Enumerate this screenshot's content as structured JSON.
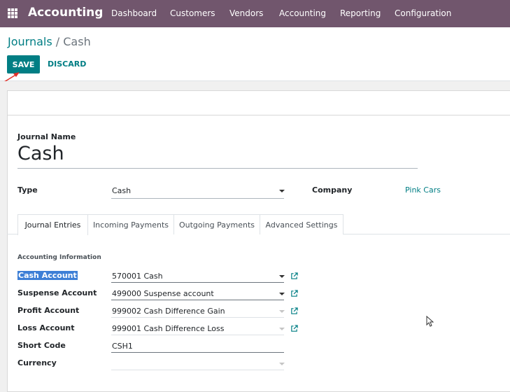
{
  "navbar": {
    "app_name": "Accounting",
    "menu": [
      "Dashboard",
      "Customers",
      "Vendors",
      "Accounting",
      "Reporting",
      "Configuration"
    ]
  },
  "breadcrumb": {
    "parent": "Journals",
    "separator": "/",
    "current": "Cash"
  },
  "buttons": {
    "save": "SAVE",
    "discard": "DISCARD"
  },
  "form": {
    "journal_name_label": "Journal Name",
    "journal_name": "Cash",
    "type_label": "Type",
    "type_value": "Cash",
    "company_label": "Company",
    "company_value": "Pink Cars"
  },
  "tabs": [
    "Journal Entries",
    "Incoming Payments",
    "Outgoing Payments",
    "Advanced Settings"
  ],
  "accounting": {
    "section_title": "Accounting Information",
    "cash_account_label": "Cash Account",
    "cash_account_value": "570001 Cash",
    "suspense_account_label": "Suspense Account",
    "suspense_account_value": "499000 Suspense account",
    "profit_account_label": "Profit Account",
    "profit_account_value": "999002 Cash Difference Gain",
    "loss_account_label": "Loss Account",
    "loss_account_value": "999001 Cash Difference Loss",
    "short_code_label": "Short Code",
    "short_code_value": "CSH1",
    "currency_label": "Currency",
    "currency_value": ""
  },
  "colors": {
    "navbar": "#71566d",
    "primary": "#017e84",
    "highlight": "#3d7fd6"
  }
}
